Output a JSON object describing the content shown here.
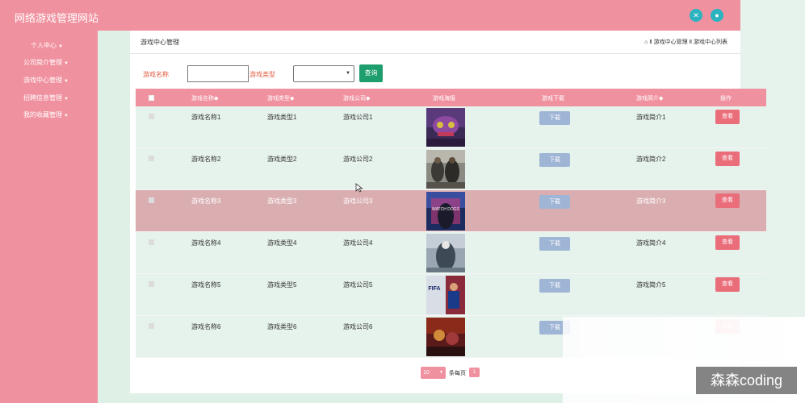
{
  "app": {
    "title": "网络游戏管理网站"
  },
  "topbar": {
    "icons": [
      "expand-icon",
      "user-icon"
    ]
  },
  "sidebar": {
    "items": [
      {
        "label": "个人中心"
      },
      {
        "label": "公司简介管理"
      },
      {
        "label": "游戏中心管理"
      },
      {
        "label": "招聘信息管理"
      },
      {
        "label": "我的收藏管理"
      }
    ]
  },
  "panel": {
    "title": "游戏中心管理",
    "breadcrumb": "⌂ Ⅱ 游戏中心管理 Ⅱ 游戏中心列表"
  },
  "search": {
    "name_label": "游戏名称",
    "name_value": "",
    "type_label": "游戏类型",
    "type_value": "",
    "button_label": "查询"
  },
  "table": {
    "columns": [
      "游戏名称◆",
      "游戏类型◆",
      "游戏公司◆",
      "游戏海报",
      "游戏下载",
      "游戏简介◆",
      "操作"
    ],
    "download_label": "下载",
    "view_label": "查看",
    "rows": [
      {
        "name": "游戏名称1",
        "type": "游戏类型1",
        "company": "游戏公司1",
        "intro": "游戏简介1"
      },
      {
        "name": "游戏名称2",
        "type": "游戏类型2",
        "company": "游戏公司2",
        "intro": "游戏简介2"
      },
      {
        "name": "游戏名称3",
        "type": "游戏类型3",
        "company": "游戏公司3",
        "intro": "游戏简介3",
        "poster_text": "WATCH DOGS"
      },
      {
        "name": "游戏名称4",
        "type": "游戏类型4",
        "company": "游戏公司4",
        "intro": "游戏简介4"
      },
      {
        "name": "游戏名称5",
        "type": "游戏类型5",
        "company": "游戏公司5",
        "intro": "游戏简介5",
        "poster_text": "FIFA"
      },
      {
        "name": "游戏名称6",
        "type": "游戏类型6",
        "company": "游戏公司6",
        "intro": ""
      }
    ]
  },
  "pagination": {
    "page_size": "10",
    "per_page_label": "条每页",
    "count": "1"
  },
  "watermark": "森森coding",
  "colors": {
    "brand_pink": "#f0919f",
    "search_btn": "#1e9e6d",
    "view_btn": "#ea6d7a",
    "download_btn": "#9fb5d5",
    "row_bg": "#e6f2ec",
    "highlight_row": "#daaeb1"
  }
}
